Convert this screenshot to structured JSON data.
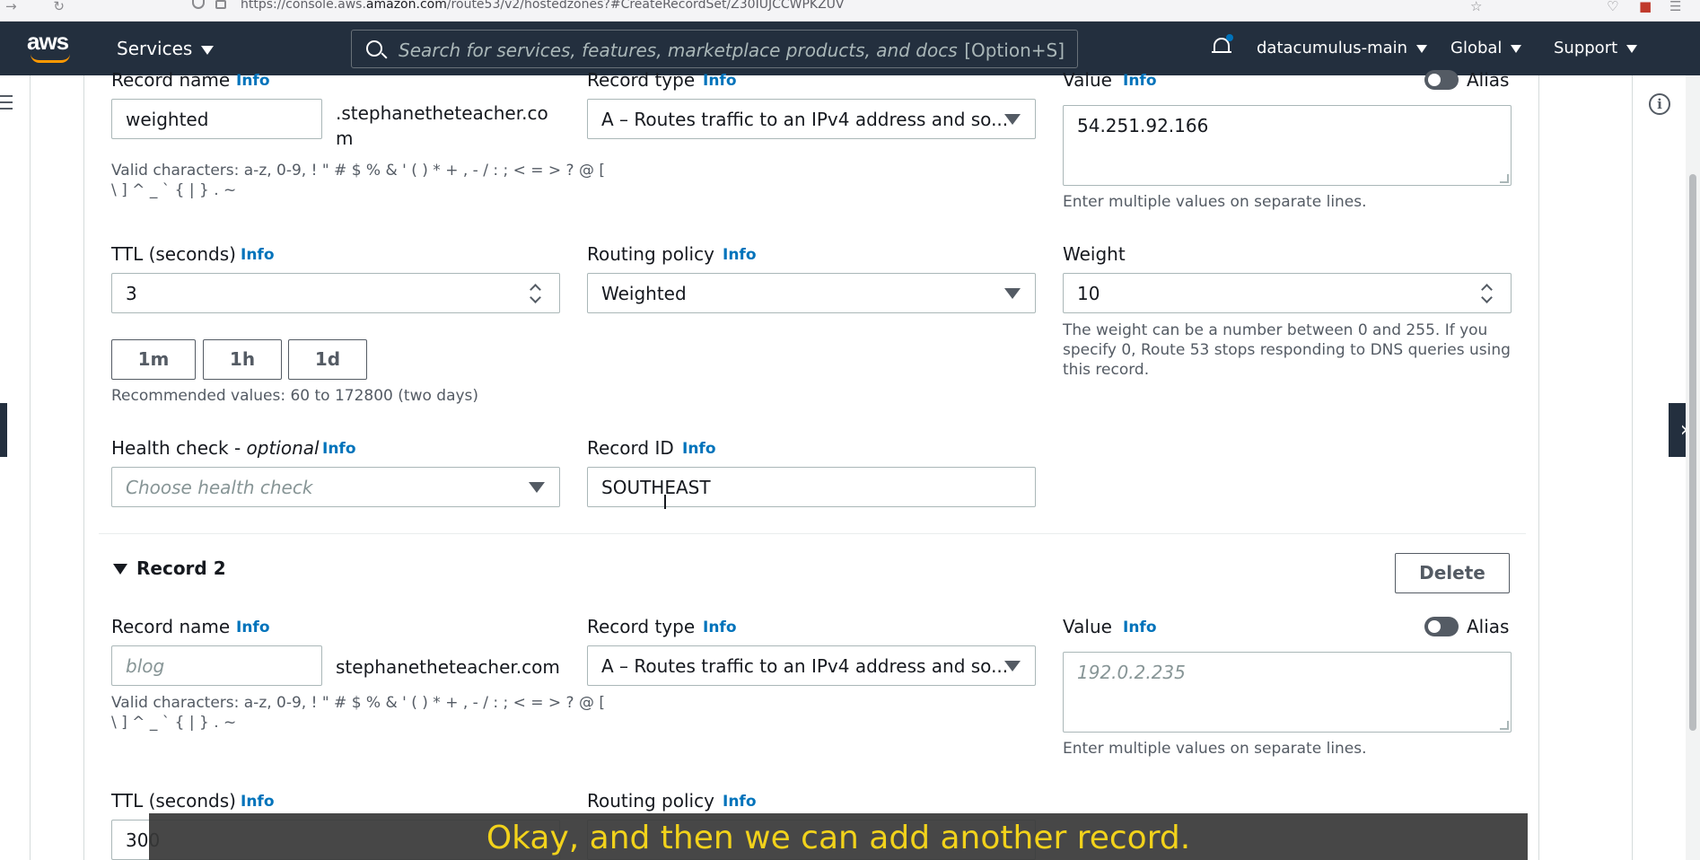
{
  "browser": {
    "url_prefix": "https://console.aws.",
    "url_domain": "amazon.com",
    "url_rest": "/route53/v2/hostedzones?#CreateRecordSet/Z30IUJCCWPKZUV"
  },
  "header": {
    "logo": "aws",
    "services": "Services",
    "search_placeholder": "Search for services, features, marketplace products, and docs",
    "search_shortcut": "[Option+S]",
    "account": "datacumulus-main",
    "region": "Global",
    "support": "Support"
  },
  "record1": {
    "record_name_label": "Record name",
    "record_name_info": "Info",
    "record_name_value": "weighted",
    "domain_suffix_line1": ".stephanetheteacher.co",
    "domain_suffix_line2": "m",
    "valid_chars_line1": "Valid characters: a-z, 0-9, ! \" # $ % & ' ( ) * + , - / : ; < = > ? @ [",
    "valid_chars_line2": "\\ ] ^ _ ` { | } . ~",
    "record_type_label": "Record type",
    "record_type_info": "Info",
    "record_type_value": "A – Routes traffic to an IPv4 address and so...",
    "value_label": "Value",
    "value_info": "Info",
    "alias_label": "Alias",
    "value_value": "54.251.92.166",
    "value_hint": "Enter multiple values on separate lines.",
    "ttl_label": "TTL (seconds)",
    "ttl_info": "Info",
    "ttl_value": "3",
    "ttl_btn_1m": "1m",
    "ttl_btn_1h": "1h",
    "ttl_btn_1d": "1d",
    "ttl_hint": "Recommended values: 60 to 172800 (two days)",
    "routing_label": "Routing policy",
    "routing_info": "Info",
    "routing_value": "Weighted",
    "weight_label": "Weight",
    "weight_value": "10",
    "weight_hint_1": "The weight can be a number between 0 and 255. If you",
    "weight_hint_2": "specify 0, Route 53 stops responding to DNS queries using",
    "weight_hint_3": "this record.",
    "health_label": "Health check - ",
    "health_label_optional": "optional",
    "health_info": "Info",
    "health_placeholder": "Choose health check",
    "record_id_label": "Record ID",
    "record_id_info": "Info",
    "record_id_value": "SOUTHEAST"
  },
  "record2": {
    "title": "Record 2",
    "delete": "Delete",
    "record_name_label": "Record name",
    "record_name_info": "Info",
    "record_name_placeholder": "blog",
    "domain_suffix": "stephanetheteacher.com",
    "valid_chars_line1": "Valid characters: a-z, 0-9, ! \" # $ % & ' ( ) * + , - / : ; < = > ? @ [",
    "valid_chars_line2": "\\ ] ^ _ ` { | } . ~",
    "record_type_label": "Record type",
    "record_type_info": "Info",
    "record_type_value": "A – Routes traffic to an IPv4 address and so...",
    "value_label": "Value",
    "value_info": "Info",
    "alias_label": "Alias",
    "value_placeholder": "192.0.2.235",
    "value_hint": "Enter multiple values on separate lines.",
    "ttl_label": "TTL (seconds)",
    "ttl_info": "Info",
    "ttl_value": "300",
    "routing_label": "Routing policy",
    "routing_info": "Info"
  },
  "caption": "Okay, and then we can add another record."
}
